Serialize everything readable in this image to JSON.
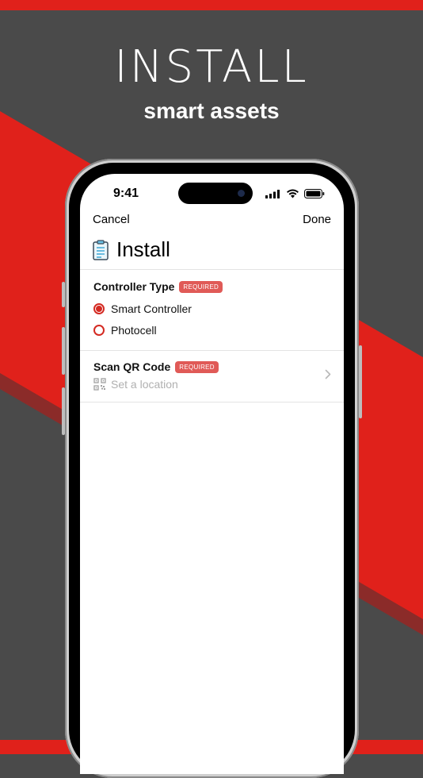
{
  "hero": {
    "title": "INSTALL",
    "subtitle": "smart assets"
  },
  "status_bar": {
    "time": "9:41"
  },
  "nav": {
    "cancel_label": "Cancel",
    "done_label": "Done"
  },
  "page": {
    "title": "Install",
    "title_icon": "clipboard-icon"
  },
  "controller_type": {
    "label": "Controller Type",
    "badge": "REQUIRED",
    "options": [
      {
        "label": "Smart Controller",
        "selected": true
      },
      {
        "label": "Photocell",
        "selected": false
      }
    ]
  },
  "scan_qr": {
    "label": "Scan QR Code",
    "badge": "REQUIRED",
    "placeholder": "Set a location",
    "icon": "qr-code-icon"
  },
  "colors": {
    "brand_red": "#e0211b",
    "background_gray": "#4a4a4a",
    "badge_red": "#e05a57",
    "radio_red": "#d42a22"
  }
}
